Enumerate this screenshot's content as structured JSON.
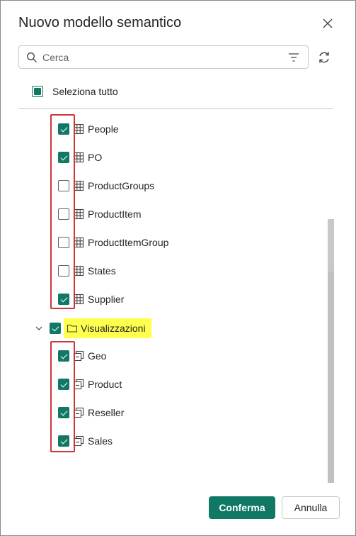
{
  "dialog": {
    "title": "Nuovo modello semantico",
    "close_icon": "close-icon"
  },
  "search": {
    "placeholder": "Cerca",
    "value": "",
    "search_icon": "search-icon",
    "filter_icon": "filter-icon"
  },
  "refresh_icon": "refresh-icon",
  "select_all": {
    "label": "Seleziona tutto",
    "state": "indeterminate"
  },
  "tables": [
    {
      "label": "People",
      "checked": true,
      "icon": "table-icon"
    },
    {
      "label": "PO",
      "checked": true,
      "icon": "table-icon"
    },
    {
      "label": "ProductGroups",
      "checked": false,
      "icon": "table-icon"
    },
    {
      "label": "ProductItem",
      "checked": false,
      "icon": "table-icon"
    },
    {
      "label": "ProductItemGroup",
      "checked": false,
      "icon": "table-icon"
    },
    {
      "label": "States",
      "checked": false,
      "icon": "table-icon"
    },
    {
      "label": "Supplier",
      "checked": true,
      "icon": "table-icon"
    }
  ],
  "views_folder": {
    "label": "Visualizzazioni",
    "checked": true,
    "expanded": true,
    "icon": "folder-icon",
    "highlight_color": "#ffff4d"
  },
  "views": [
    {
      "label": "Geo",
      "checked": true,
      "icon": "view-icon"
    },
    {
      "label": "Product",
      "checked": true,
      "icon": "view-icon"
    },
    {
      "label": "Reseller",
      "checked": true,
      "icon": "view-icon"
    },
    {
      "label": "Sales",
      "checked": true,
      "icon": "view-icon"
    }
  ],
  "footer": {
    "confirm_label": "Conferma",
    "cancel_label": "Annulla"
  },
  "colors": {
    "accent": "#117865",
    "annotation_red": "#d13438"
  }
}
